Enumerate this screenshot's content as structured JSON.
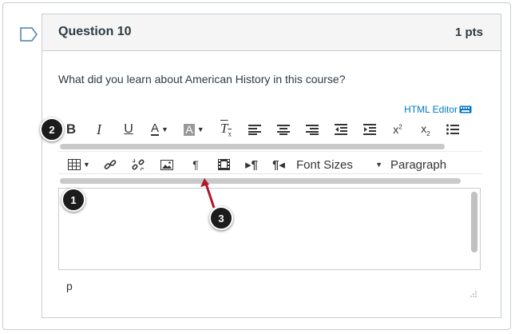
{
  "question": {
    "title": "Question 10",
    "points": "1 pts",
    "text": "What did you learn about American History in this course?"
  },
  "editor": {
    "html_editor_label": "HTML Editor",
    "row1": [
      "bold-icon",
      "italic-icon",
      "underline-icon",
      "text-color-icon",
      "background-color-icon",
      "clear-formatting-icon",
      "align-left-icon",
      "align-center-icon",
      "align-right-icon",
      "outdent-icon",
      "indent-icon",
      "superscript-icon",
      "subscript-icon",
      "bullet-list-icon"
    ],
    "row2": [
      "table-icon",
      "link-icon",
      "unlink-icon",
      "image-icon",
      "pilcrow-icon",
      "media-icon",
      "ltr-icon",
      "rtl-icon"
    ],
    "font_sizes_label": "Font Sizes",
    "paragraph_label": "Paragraph",
    "path": "p"
  },
  "callouts": {
    "one": "1",
    "two": "2",
    "three": "3"
  },
  "colors": {
    "link": "#0077cc",
    "arrow": "#b0182a",
    "callout": "#1c1c1c"
  }
}
